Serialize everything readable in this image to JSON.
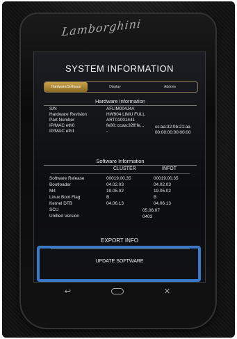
{
  "brand": "Lamborghini",
  "screen": {
    "title": "SYSTEM INFORMATION",
    "tabs": [
      "Hardware/Software",
      "Display",
      "Addons"
    ],
    "hardware": {
      "heading": "Hardware Information",
      "rows": [
        {
          "label": "S/N",
          "value": "AFLIM004J4A"
        },
        {
          "label": "Hardware Revision",
          "value": "HW904 LIMU FULL"
        },
        {
          "label": "Part Number",
          "value": "ART01001441"
        },
        {
          "label": "IP/MAC eth0",
          "value": "fe80::ccaa:32ff:fe...",
          "extra": "cc:aa:32:0b:21:aa"
        },
        {
          "label": "IP/MAC eth1",
          "value": "-",
          "extra": "00:00:00:00:00:00"
        }
      ]
    },
    "software": {
      "heading": "Software Information",
      "col_cluster": "CLUSTER",
      "col_infot": "INFOT",
      "rows": [
        {
          "label": "Software Release",
          "cluster": "00019.00.35",
          "infot": "00019.00.35"
        },
        {
          "label": "Bootloader",
          "cluster": "04.02.03",
          "infot": "04.02.03"
        },
        {
          "label": "M4",
          "cluster": "19.05.02",
          "infot": "19.05.02"
        },
        {
          "label": "Linux Boot Flag",
          "cluster": "B",
          "infot": "B"
        },
        {
          "label": "Kernel DTB",
          "cluster": "04.06.13",
          "infot": "04.06.13"
        },
        {
          "label": "SCU",
          "cluster": "",
          "infot": "05.06.07"
        },
        {
          "label": "Unified Version",
          "cluster": "",
          "infot": "0403"
        }
      ]
    },
    "export_label": "EXPORT INFO",
    "update_label": "UPDATE SOFTWARE"
  },
  "nav": {
    "back": "↩",
    "close": "✕"
  },
  "colors": {
    "highlight": "#3a78c8",
    "tab_active": "#b08a35"
  }
}
